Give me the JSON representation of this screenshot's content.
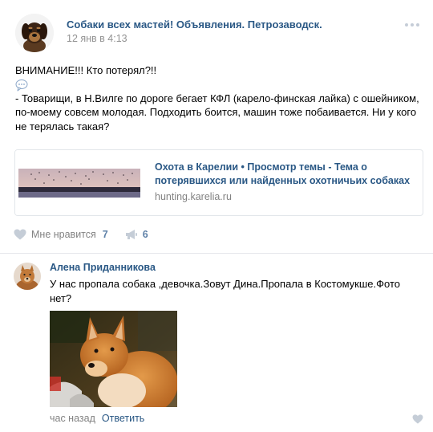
{
  "post": {
    "author": "Собаки всех мастей! Объявления. Петрозаводск.",
    "date": "12 янв в 4:13",
    "text_lines": [
      "ВНИМАНИЕ!!! Кто потерял?!!",
      "- Товарищи, в Н.Вилге по дороге бегает КФЛ (карело-финская лайка) с ошейником,",
      "по-моему совсем молодая. Подходить боится, машин тоже побаивается. Ни у кого",
      "не терялась такая?"
    ],
    "link": {
      "title_line1": "Охота в Карелии • Просмотр темы - Тема о",
      "title_line2": "потерявшихся или найденных охотничьих собаках",
      "domain": "hunting.karelia.ru"
    },
    "actions": {
      "like_label": "Мне нравится",
      "like_count": "7",
      "share_count": "6"
    }
  },
  "comment": {
    "author": "Алена Приданникова",
    "text_line1": "У нас пропала собака ,девочка.Зовут Дина.Пропала в Костомукше.Фото",
    "text_line2": "нет?",
    "time": "час назад",
    "reply_label": "Ответить"
  },
  "icons": {
    "menu": "more-dots-icon",
    "emoji": "speech-balloon-icon",
    "like": "heart-icon",
    "share": "megaphone-icon"
  },
  "colors": {
    "link": "#2a5885",
    "muted": "#828282",
    "count": "#5e81a8",
    "icon": "#c5cdd7"
  }
}
